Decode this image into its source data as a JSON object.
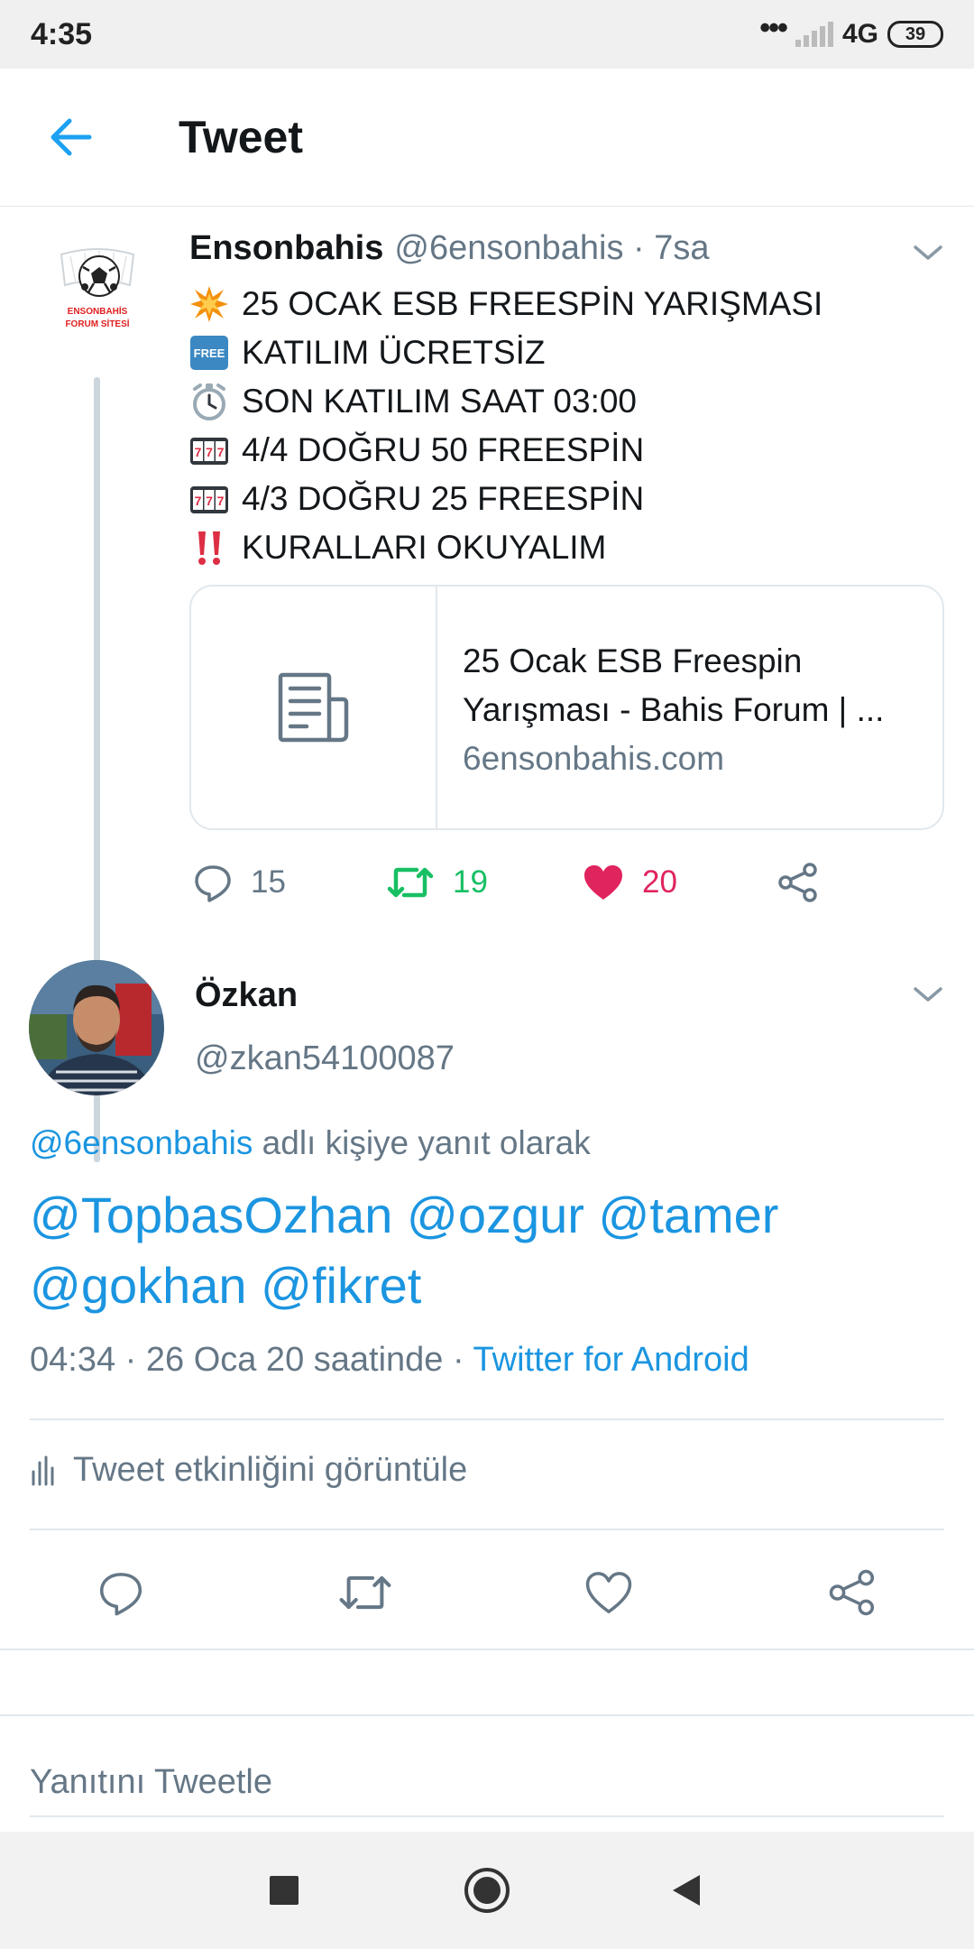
{
  "status_bar": {
    "time": "4:35",
    "dots": "•••",
    "network": "4G",
    "battery": "39"
  },
  "header": {
    "title": "Tweet",
    "back_icon": "arrow-left-icon"
  },
  "parent_tweet": {
    "avatar_text_1": "ENSONBAHİS",
    "avatar_text_2": "FORUM SİTESİ",
    "name": "Ensonbahis",
    "meta": "@6ensonbahis · 7sa",
    "lines": [
      {
        "icon": "collision-emoji-icon",
        "text": "25 OCAK ESB FREESPİN YARIŞMASI"
      },
      {
        "icon": "free-button-emoji-icon",
        "text": "KATILIM ÜCRETSİZ"
      },
      {
        "icon": "alarm-clock-emoji-icon",
        "text": "SON KATILIM SAAT 03:00"
      },
      {
        "icon": "slot-machine-emoji-icon",
        "text": "4/4 DOĞRU 50 FREESPİN"
      },
      {
        "icon": "slot-machine-emoji-icon",
        "text": "4/3 DOĞRU 25 FREESPİN"
      },
      {
        "icon": "double-exclamation-emoji-icon",
        "text": "KURALLARI OKUYALIM"
      }
    ],
    "free_badge": "FREE",
    "card": {
      "title_line_1": "25 Ocak ESB Freespin",
      "title_line_2": "Yarışması - Bahis Forum | ...",
      "domain": "6ensonbahis.com"
    },
    "actions": {
      "replies": "15",
      "retweets": "19",
      "likes": "20"
    },
    "colors": {
      "retweet": "#17bf63",
      "like": "#e0245e"
    }
  },
  "main_tweet": {
    "name": "Özkan",
    "handle": "@zkan54100087",
    "reply_to_mention": "@6ensonbahis",
    "reply_to_suffix": " adlı kişiye yanıt olarak",
    "text_line_1": "@TopbasOzhan @ozgur @tamer",
    "text_line_2": "@gokhan @fikret",
    "timestamp": "04:34 · 26 Oca 20 saatinde · ",
    "source": "Twitter for Android",
    "activity_label": "Tweet etkinliğini görüntüle"
  },
  "reply_box": {
    "placeholder": "Yanıtını Tweetle"
  },
  "colors": {
    "accent": "#1b95e0",
    "muted": "#657786",
    "border": "#e1e8ed"
  }
}
